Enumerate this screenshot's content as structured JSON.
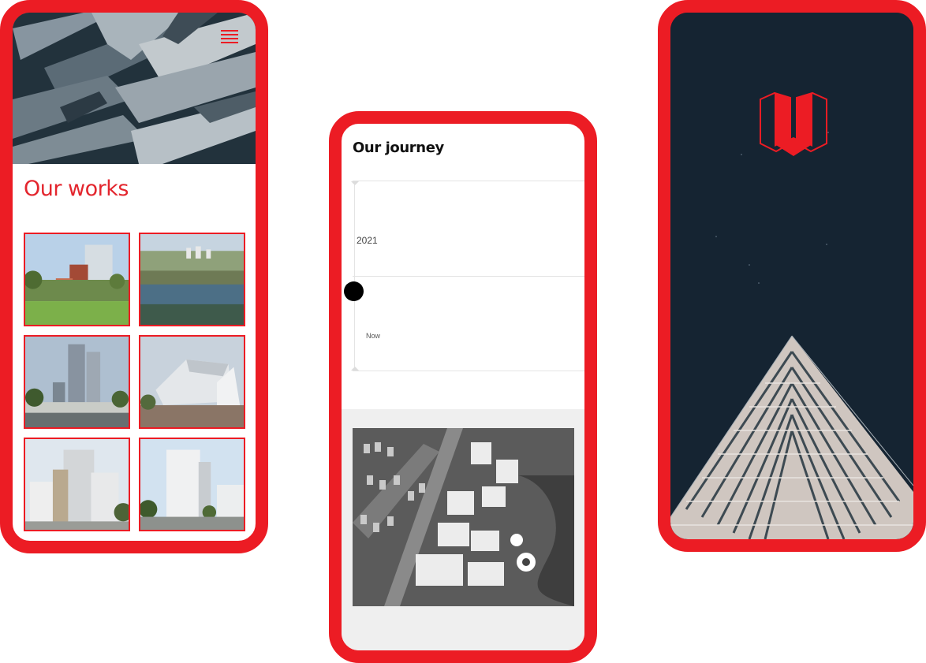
{
  "works_screen": {
    "title": "Our works",
    "menu_icon": "hamburger-menu-icon",
    "hero_image": "architecture-facade-photo",
    "thumbnails": [
      {
        "image": "project-photo-1"
      },
      {
        "image": "project-photo-2"
      },
      {
        "image": "project-photo-3"
      },
      {
        "image": "project-photo-4"
      },
      {
        "image": "project-photo-5"
      },
      {
        "image": "project-photo-6"
      }
    ]
  },
  "journey_screen": {
    "title": "Our journey",
    "timeline": [
      {
        "label": "2021"
      },
      {
        "label": "Now"
      }
    ],
    "map_image": "aerial-site-map"
  },
  "splash_screen": {
    "logo_icon": "brand-logo-icon",
    "background_image": "tower-at-night-photo"
  },
  "colors": {
    "accent": "#ec1c24",
    "title_red": "#e3262e",
    "splash_bg": "#142431",
    "map_section_bg": "#efefef"
  }
}
